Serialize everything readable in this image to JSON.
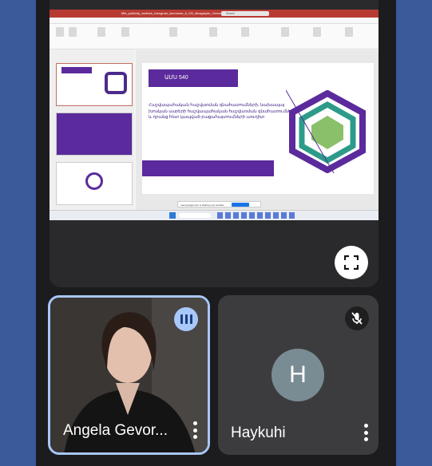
{
  "screen_share": {
    "doc_title": "Mkt_publicity_ssdinos_harugnan_ssnnonas_6_Vi3_dibagalyan_Vdocs) ~ Saved to",
    "search_text": "Search",
    "menu": [
      "File",
      "Home",
      "Insert",
      "Draw",
      "Design",
      "Transitions",
      "Animations",
      "Slide Show",
      "Record",
      "Review",
      "View",
      "Help",
      "Acrobat"
    ],
    "slide": {
      "tag": "ԱՄՍ 540",
      "body": "Հաշվապահական հաշվառման գնահատումների, նախապայ խոսկան սարերի հաշվապահական հաշվառման գնահատումների և դրանց հետ կապված բացահայտումների աուդիտ"
    },
    "notification": "meet.google.com is sharing your window.",
    "notify_button": "Stop sharing",
    "notify_hide": "Hide"
  },
  "participants": [
    {
      "name": "Angela Gevor...",
      "speaking": true
    },
    {
      "name": "Haykuhi",
      "initial": "H",
      "muted": true,
      "avatar_color": "#7a8c93"
    }
  ],
  "icons": [
    "expand-icon",
    "more-vert-icon",
    "mic-off-icon",
    "audio-level-icon"
  ]
}
